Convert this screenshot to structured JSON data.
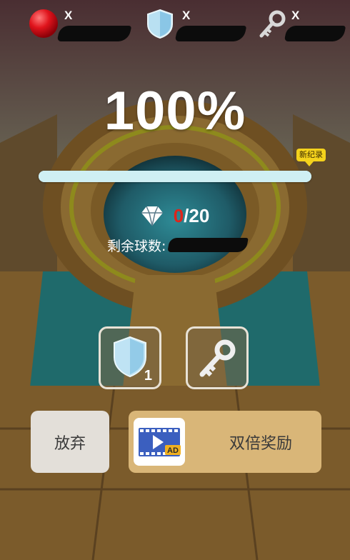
{
  "resources": [
    {
      "name": "ball",
      "icon": "red-ball-icon",
      "multiplier": "X",
      "value_redacted": true
    },
    {
      "name": "shield",
      "icon": "shield-icon",
      "multiplier": "X",
      "value_redacted": true
    },
    {
      "name": "key",
      "icon": "key-icon",
      "multiplier": "X",
      "value_redacted": true
    }
  ],
  "progress": {
    "percent_text": "100%",
    "fill": 1.0,
    "record_label": "新纪录"
  },
  "gems": {
    "icon": "diamond-icon",
    "collected": "0",
    "separator": "/",
    "total": "20"
  },
  "balls_left": {
    "label": "剩余球数:",
    "value_redacted": true
  },
  "powerups": [
    {
      "name": "shield",
      "icon": "shield-icon",
      "count": "1"
    },
    {
      "name": "key",
      "icon": "key-icon",
      "count": ""
    }
  ],
  "buttons": {
    "give_up": "放弃",
    "double_reward": "双倍奖励",
    "ad_icon": "video-ad-icon",
    "ad_text": "AD"
  },
  "colors": {
    "accent_red": "#e0241a",
    "button_gold": "#d9b678",
    "button_grey": "#e3dfd9",
    "badge_yellow": "#f4d21c"
  }
}
